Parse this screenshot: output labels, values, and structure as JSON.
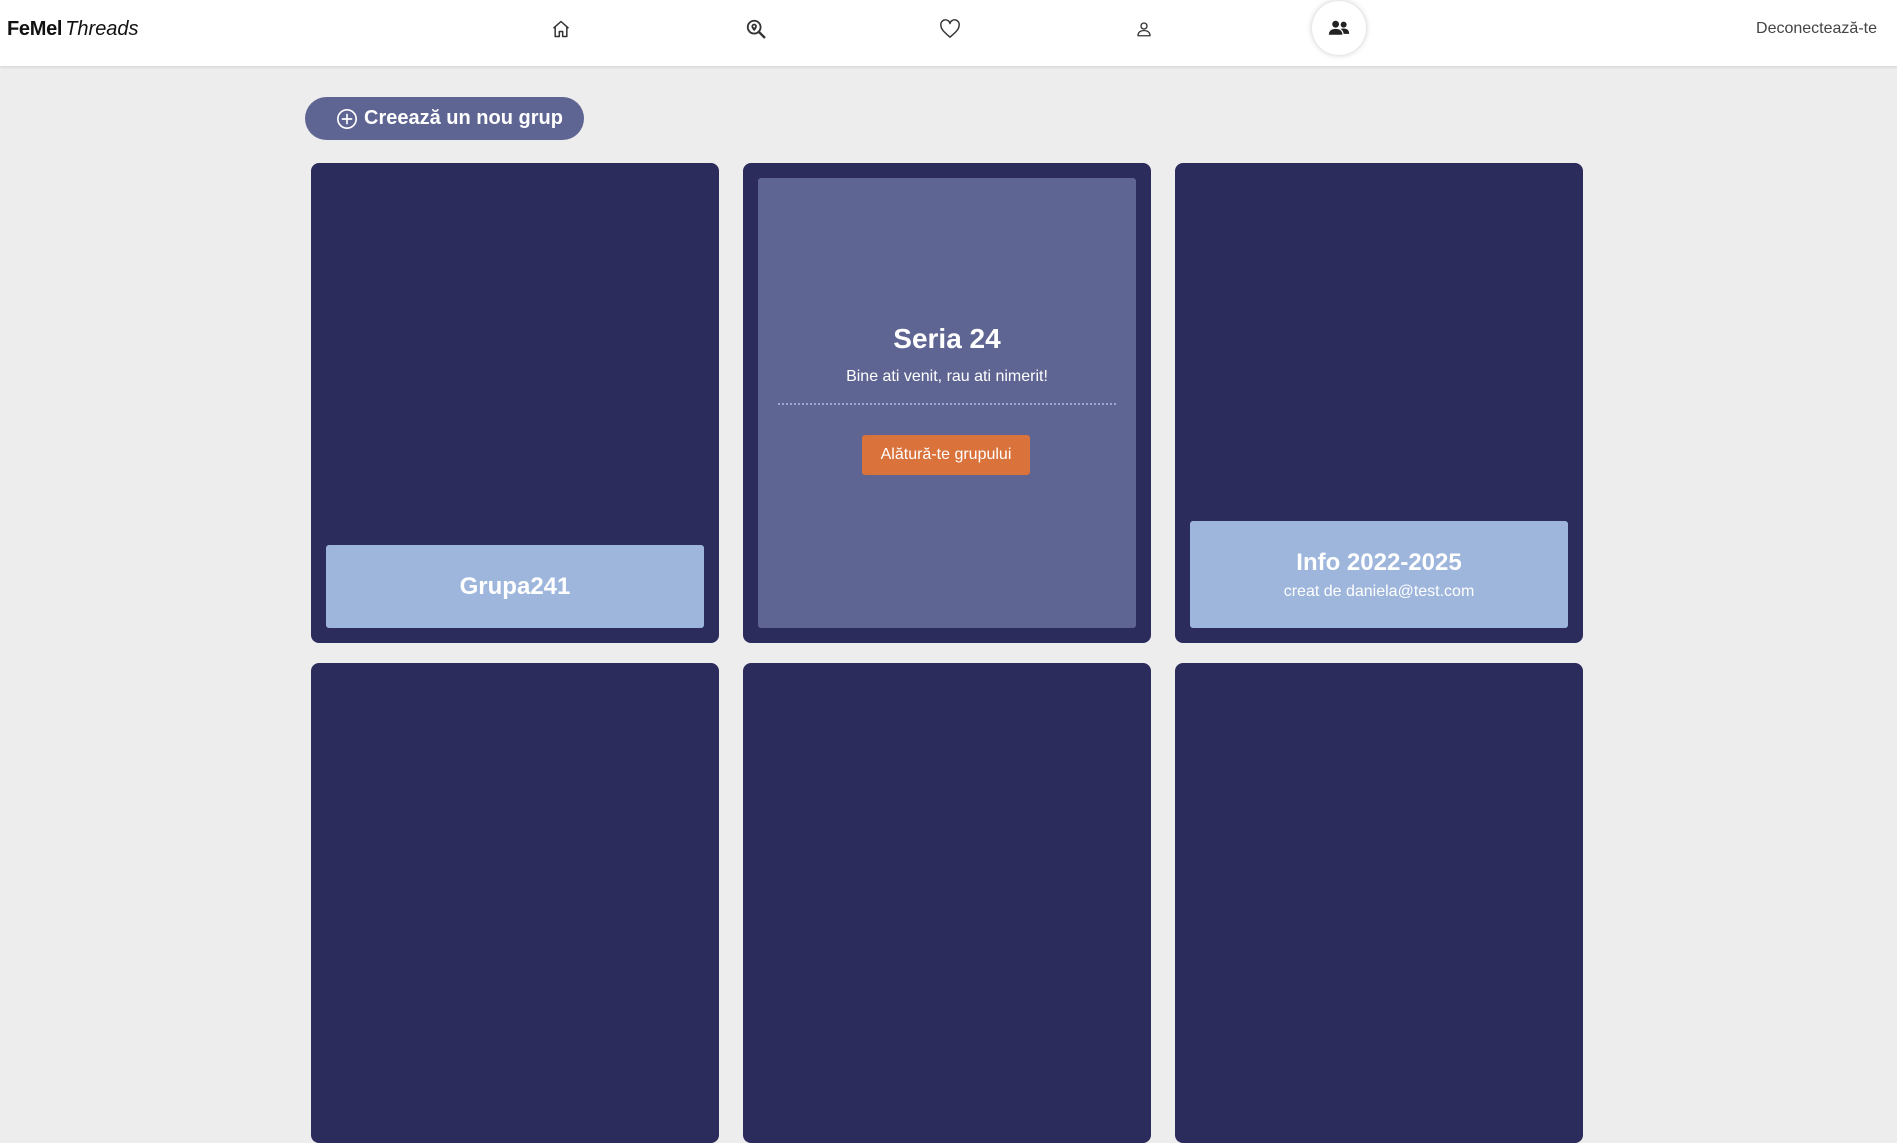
{
  "app": {
    "brand_bold": "FeMel",
    "brand_italic": "Threads"
  },
  "nav": {
    "icons": [
      "home-icon",
      "search-location-icon",
      "heart-icon",
      "user-icon",
      "groups-icon"
    ],
    "active": "groups-icon",
    "logout_label": "Deconectează-te"
  },
  "actions": {
    "create_group_label": "Creează un nou grup"
  },
  "groups": [
    {
      "name": "Grupa241"
    },
    {
      "name": "Seria 24",
      "description": "Bine ati venit, rau ati nimerit!",
      "join_label": "Alătură-te grupului"
    },
    {
      "name": "Info 2022-2025",
      "creator": "creat de daniela@test.com"
    }
  ],
  "colors": {
    "card_bg": "#2b2b5c",
    "label_bg": "#9eb6dc",
    "overlay_bg": "#5f6593",
    "join_button": "#d9723b",
    "page_bg": "#ededed"
  }
}
